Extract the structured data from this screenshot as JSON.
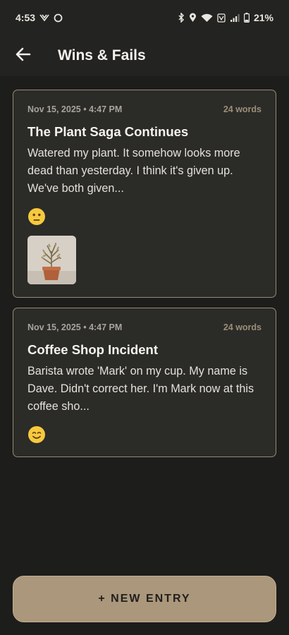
{
  "status_bar": {
    "time": "4:53",
    "battery": "21%"
  },
  "header": {
    "title": "Wins & Fails",
    "back_icon": "arrow-left-icon"
  },
  "entries": [
    {
      "date": "Nov 15, 2025 • 4:47 PM",
      "words": "24 words",
      "title": "The Plant Saga Continues",
      "body": "Watered my plant. It somehow looks more dead than yesterday. I think it's given up. We've both given...",
      "mood_icon": "neutral-face-icon",
      "has_image": true
    },
    {
      "date": "Nov 15, 2025 • 4:47 PM",
      "words": "24 words",
      "title": "Coffee Shop Incident",
      "body": "Barista wrote 'Mark' on my cup. My name is Dave. Didn't correct her. I'm Mark now at this coffee sho...",
      "mood_icon": "smiling-face-icon",
      "has_image": false
    }
  ],
  "new_entry_button": {
    "label": "+ NEW ENTRY"
  },
  "colors": {
    "background": "#1d1d1b",
    "card": "#2b2b28",
    "card_border": "#9a8a70",
    "accent_button": "#ab977b"
  }
}
